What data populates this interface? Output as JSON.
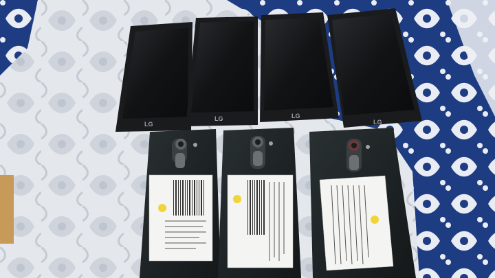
{
  "photo": {
    "subject": "",
    "colors": {
      "sheet_light": "#e6e8ed",
      "sheet_pattern": "#c9ced8",
      "sheet_blue": "#1f3f86",
      "phone_front": "#1a1b1d",
      "phone_screen": "#0f1012",
      "phone_back": "#202527",
      "sticker": "#f4f4f2",
      "accent_yellow": "#f1d43a"
    }
  },
  "front_phones": [
    {
      "brand": "LG"
    },
    {
      "brand": "LG"
    },
    {
      "brand": "LG"
    },
    {
      "brand": "LG"
    }
  ],
  "back_phones": [
    {
      "brand": ""
    },
    {
      "brand": ""
    },
    {
      "brand": ""
    }
  ]
}
